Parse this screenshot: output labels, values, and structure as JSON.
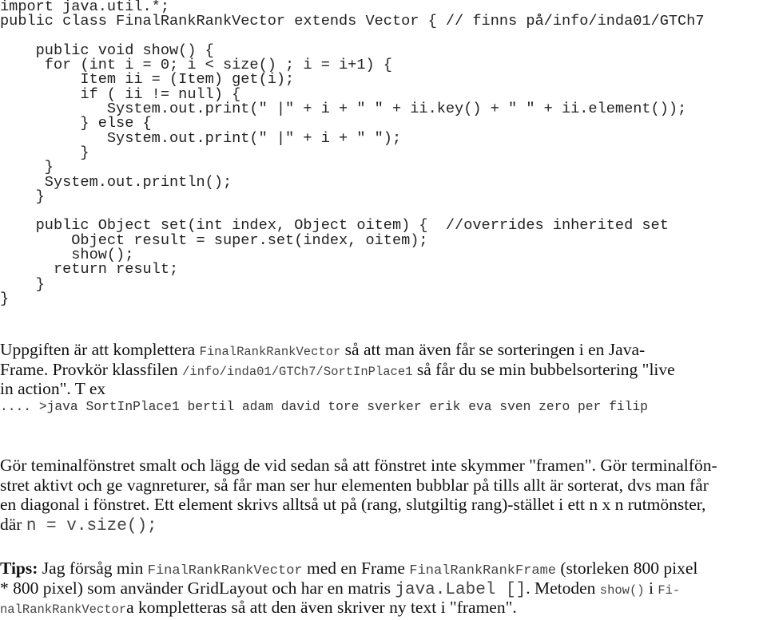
{
  "code": {
    "lines": [
      "import java.util.*;",
      "public class FinalRankRankVector extends Vector { // finns på/info/inda01/GTCh7",
      "",
      "    public void show() {",
      "     for (int i = 0; i < size() ; i = i+1) {",
      "         Item ii = (Item) get(i);",
      "         if ( ii != null) {",
      "            System.out.print(\" |\" + i + \" \" + ii.key() + \" \" + ii.element());",
      "         } else {",
      "            System.out.print(\" |\" + i + \" \");",
      "         }",
      "     }",
      "     System.out.println();",
      "    }",
      "",
      "    public Object set(int index, Object oitem) {  //overrides inherited set",
      "        Object result = super.set(index, oitem);",
      "        show();",
      "      return result;",
      "    }",
      "}"
    ]
  },
  "task": {
    "l1_a": "Uppgiften är att komplettera ",
    "l1_code": "FinalRankRankVector",
    "l1_b": "  så att man även får se sorteringen i en Java-",
    "l2_a": "Frame. Provkör klassfilen ",
    "l2_code": "/info/inda01/GTCh7/SortInPlace1",
    "l2_b": "  så får du se min bubbelsortering \"live",
    "l3": "in action\".  T ex"
  },
  "command": ".... >java SortInPlace1 bertil adam david tore sverker erik eva sven zero per filip",
  "instructions": {
    "l1": "Gör teminalfönstret smalt och lägg de vid sedan så att fönstret inte skymmer \"framen\". Gör terminalfön-",
    "l2": "stret aktivt och ge vagnreturer, så får man ser hur elementen bubblar på tills allt är sorterat, dvs man får",
    "l3": "en diagonal i fönstret. Ett element skrivs alltså ut på (rang, slutgiltig rang)-stället i ett n x n rutmönster,",
    "l4_a": "där ",
    "l4_code": "n = v.size();"
  },
  "tips": {
    "label": "Tips:",
    "l1_a": " Jag försåg min ",
    "l1_code1": "FinalRankRankVector",
    "l1_b": " med en Frame ",
    "l1_code2": "FinalRankRankFrame",
    "l1_c": "  (storleken 800 pixel",
    "l2_a": "* 800 pixel) som använder GridLayout och har en matris  ",
    "l2_code1": "java.Label  []",
    "l2_b": ". Metoden ",
    "l2_code2": "show()",
    "l2_c": " i ",
    "l2_code3": "Fi-",
    "l3_code": "nalRankRankVector",
    "l3_b": "a kompletteras så att den även skriver ny text i \"framen\"."
  }
}
